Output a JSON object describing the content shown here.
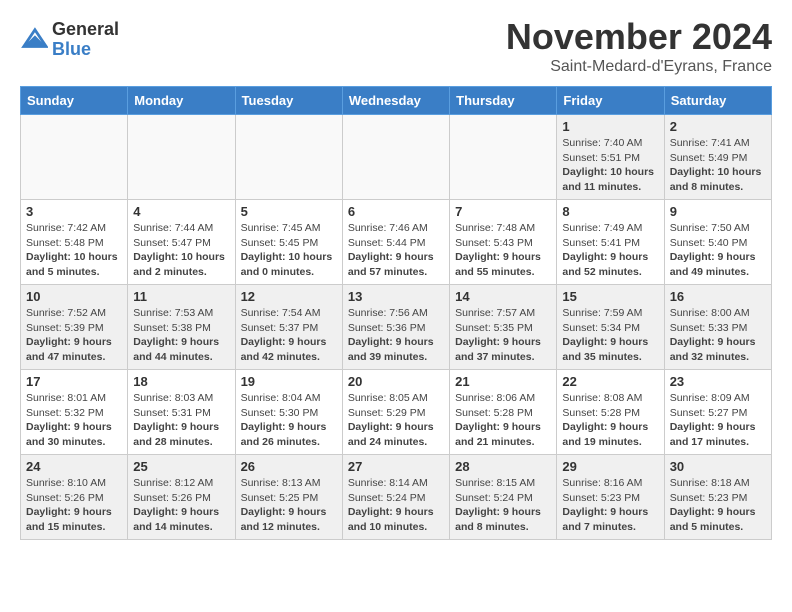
{
  "header": {
    "logo_general": "General",
    "logo_blue": "Blue",
    "month_title": "November 2024",
    "subtitle": "Saint-Medard-d'Eyrans, France"
  },
  "weekdays": [
    "Sunday",
    "Monday",
    "Tuesday",
    "Wednesday",
    "Thursday",
    "Friday",
    "Saturday"
  ],
  "weeks": [
    [
      {
        "day": "",
        "text": ""
      },
      {
        "day": "",
        "text": ""
      },
      {
        "day": "",
        "text": ""
      },
      {
        "day": "",
        "text": ""
      },
      {
        "day": "",
        "text": ""
      },
      {
        "day": "1",
        "text": "Sunrise: 7:40 AM\nSunset: 5:51 PM\nDaylight: 10 hours and 11 minutes."
      },
      {
        "day": "2",
        "text": "Sunrise: 7:41 AM\nSunset: 5:49 PM\nDaylight: 10 hours and 8 minutes."
      }
    ],
    [
      {
        "day": "3",
        "text": "Sunrise: 7:42 AM\nSunset: 5:48 PM\nDaylight: 10 hours and 5 minutes."
      },
      {
        "day": "4",
        "text": "Sunrise: 7:44 AM\nSunset: 5:47 PM\nDaylight: 10 hours and 2 minutes."
      },
      {
        "day": "5",
        "text": "Sunrise: 7:45 AM\nSunset: 5:45 PM\nDaylight: 10 hours and 0 minutes."
      },
      {
        "day": "6",
        "text": "Sunrise: 7:46 AM\nSunset: 5:44 PM\nDaylight: 9 hours and 57 minutes."
      },
      {
        "day": "7",
        "text": "Sunrise: 7:48 AM\nSunset: 5:43 PM\nDaylight: 9 hours and 55 minutes."
      },
      {
        "day": "8",
        "text": "Sunrise: 7:49 AM\nSunset: 5:41 PM\nDaylight: 9 hours and 52 minutes."
      },
      {
        "day": "9",
        "text": "Sunrise: 7:50 AM\nSunset: 5:40 PM\nDaylight: 9 hours and 49 minutes."
      }
    ],
    [
      {
        "day": "10",
        "text": "Sunrise: 7:52 AM\nSunset: 5:39 PM\nDaylight: 9 hours and 47 minutes."
      },
      {
        "day": "11",
        "text": "Sunrise: 7:53 AM\nSunset: 5:38 PM\nDaylight: 9 hours and 44 minutes."
      },
      {
        "day": "12",
        "text": "Sunrise: 7:54 AM\nSunset: 5:37 PM\nDaylight: 9 hours and 42 minutes."
      },
      {
        "day": "13",
        "text": "Sunrise: 7:56 AM\nSunset: 5:36 PM\nDaylight: 9 hours and 39 minutes."
      },
      {
        "day": "14",
        "text": "Sunrise: 7:57 AM\nSunset: 5:35 PM\nDaylight: 9 hours and 37 minutes."
      },
      {
        "day": "15",
        "text": "Sunrise: 7:59 AM\nSunset: 5:34 PM\nDaylight: 9 hours and 35 minutes."
      },
      {
        "day": "16",
        "text": "Sunrise: 8:00 AM\nSunset: 5:33 PM\nDaylight: 9 hours and 32 minutes."
      }
    ],
    [
      {
        "day": "17",
        "text": "Sunrise: 8:01 AM\nSunset: 5:32 PM\nDaylight: 9 hours and 30 minutes."
      },
      {
        "day": "18",
        "text": "Sunrise: 8:03 AM\nSunset: 5:31 PM\nDaylight: 9 hours and 28 minutes."
      },
      {
        "day": "19",
        "text": "Sunrise: 8:04 AM\nSunset: 5:30 PM\nDaylight: 9 hours and 26 minutes."
      },
      {
        "day": "20",
        "text": "Sunrise: 8:05 AM\nSunset: 5:29 PM\nDaylight: 9 hours and 24 minutes."
      },
      {
        "day": "21",
        "text": "Sunrise: 8:06 AM\nSunset: 5:28 PM\nDaylight: 9 hours and 21 minutes."
      },
      {
        "day": "22",
        "text": "Sunrise: 8:08 AM\nSunset: 5:28 PM\nDaylight: 9 hours and 19 minutes."
      },
      {
        "day": "23",
        "text": "Sunrise: 8:09 AM\nSunset: 5:27 PM\nDaylight: 9 hours and 17 minutes."
      }
    ],
    [
      {
        "day": "24",
        "text": "Sunrise: 8:10 AM\nSunset: 5:26 PM\nDaylight: 9 hours and 15 minutes."
      },
      {
        "day": "25",
        "text": "Sunrise: 8:12 AM\nSunset: 5:26 PM\nDaylight: 9 hours and 14 minutes."
      },
      {
        "day": "26",
        "text": "Sunrise: 8:13 AM\nSunset: 5:25 PM\nDaylight: 9 hours and 12 minutes."
      },
      {
        "day": "27",
        "text": "Sunrise: 8:14 AM\nSunset: 5:24 PM\nDaylight: 9 hours and 10 minutes."
      },
      {
        "day": "28",
        "text": "Sunrise: 8:15 AM\nSunset: 5:24 PM\nDaylight: 9 hours and 8 minutes."
      },
      {
        "day": "29",
        "text": "Sunrise: 8:16 AM\nSunset: 5:23 PM\nDaylight: 9 hours and 7 minutes."
      },
      {
        "day": "30",
        "text": "Sunrise: 8:18 AM\nSunset: 5:23 PM\nDaylight: 9 hours and 5 minutes."
      }
    ]
  ]
}
